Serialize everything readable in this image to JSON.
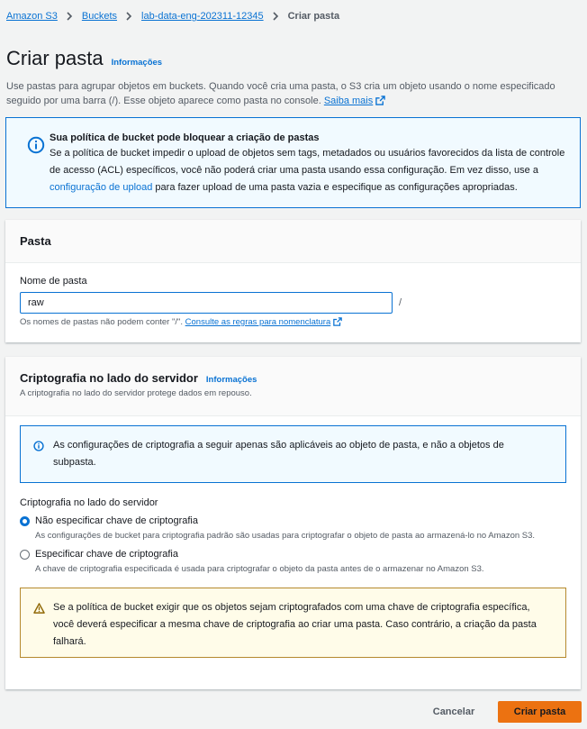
{
  "breadcrumb": {
    "items": [
      "Amazon S3",
      "Buckets",
      "lab-data-eng-202311-12345"
    ],
    "current": "Criar pasta"
  },
  "page": {
    "title": "Criar pasta",
    "info_link": "Informações",
    "description": "Use pastas para agrupar objetos em buckets. Quando você cria uma pasta, o S3 cria um objeto usando o nome especificado seguido por uma barra (/). Esse objeto aparece como pasta no console.",
    "learn_more": "Saiba mais"
  },
  "policy_alert": {
    "title": "Sua política de bucket pode bloquear a criação de pastas",
    "body_before": "Se a política de bucket impedir o upload de objetos sem tags, metadados ou usuários favorecidos da lista de controle de acesso (ACL) específicos, você não poderá criar uma pasta usando essa configuração. Em vez disso, use a ",
    "link": "configuração de upload",
    "body_after": " para fazer upload de uma pasta vazia e especifique as configurações apropriadas."
  },
  "folder_panel": {
    "title": "Pasta",
    "field_label": "Nome de pasta",
    "value": "raw",
    "suffix": "/",
    "hint": "Os nomes de pastas não podem conter \"/\".",
    "hint_link": "Consulte as regras para nomenclatura"
  },
  "encryption_panel": {
    "title": "Criptografia no lado do servidor",
    "info_link": "Informações",
    "description": "A criptografia no lado do servidor protege dados em repouso.",
    "info_text": "As configurações de criptografia a seguir apenas são aplicáveis ao objeto de pasta, e não a objetos de subpasta.",
    "group_label": "Criptografia no lado do servidor",
    "options": [
      {
        "label": "Não especificar chave de criptografia",
        "description": "As configurações de bucket para criptografia padrão são usadas para criptografar o objeto de pasta ao armazená-lo no Amazon S3.",
        "selected": true
      },
      {
        "label": "Especificar chave de criptografia",
        "description": "A chave de criptografia especificada é usada para criptografar o objeto da pasta antes de o armazenar no Amazon S3.",
        "selected": false
      }
    ],
    "warning": "Se a política de bucket exigir que os objetos sejam criptografados com uma chave de criptografia específica, você deverá especificar a mesma chave de criptografia ao criar uma pasta. Caso contrário, a criação da pasta falhará."
  },
  "actions": {
    "cancel": "Cancelar",
    "submit": "Criar pasta"
  },
  "colors": {
    "link": "#0972d3",
    "primary_button": "#ec7211",
    "info_border": "#0972d3",
    "warning_border": "#b5892e"
  },
  "icons": [
    "chevron-right-icon",
    "external-link-icon",
    "info-circle-icon",
    "warning-triangle-icon"
  ]
}
